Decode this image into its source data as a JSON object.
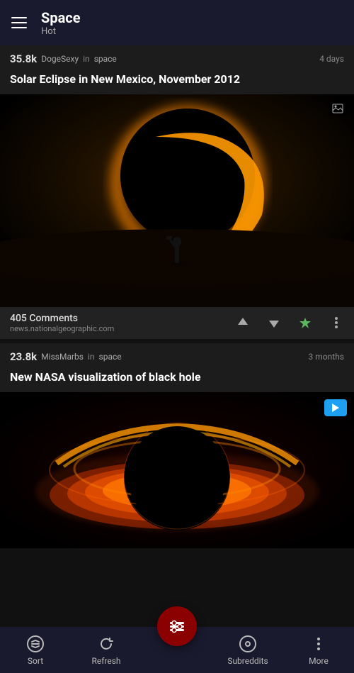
{
  "header": {
    "title": "Space",
    "subtitle": "Hot",
    "hamburger_label": "Menu"
  },
  "posts": [
    {
      "id": "post1",
      "score": "35.8k",
      "user": "DogeSexy",
      "in_label": "in",
      "subreddit": "space",
      "time": "4 days",
      "title": "Solar Eclipse in New Mexico, November 2012",
      "comments_count": "405 Comments",
      "source": "news.nationalgeographic.com",
      "image_type": "image",
      "media_type": "image"
    },
    {
      "id": "post2",
      "score": "23.8k",
      "user": "MissMarbs",
      "in_label": "in",
      "subreddit": "space",
      "time": "3 months",
      "title": "New NASA visualization of black hole",
      "comments_count": "",
      "source": "",
      "image_type": "video",
      "media_type": "video"
    }
  ],
  "bottom_nav": {
    "sort_label": "Sort",
    "refresh_label": "Refresh",
    "subreddits_label": "Subreddits",
    "more_label": "More"
  },
  "fab": {
    "label": "Filter"
  }
}
